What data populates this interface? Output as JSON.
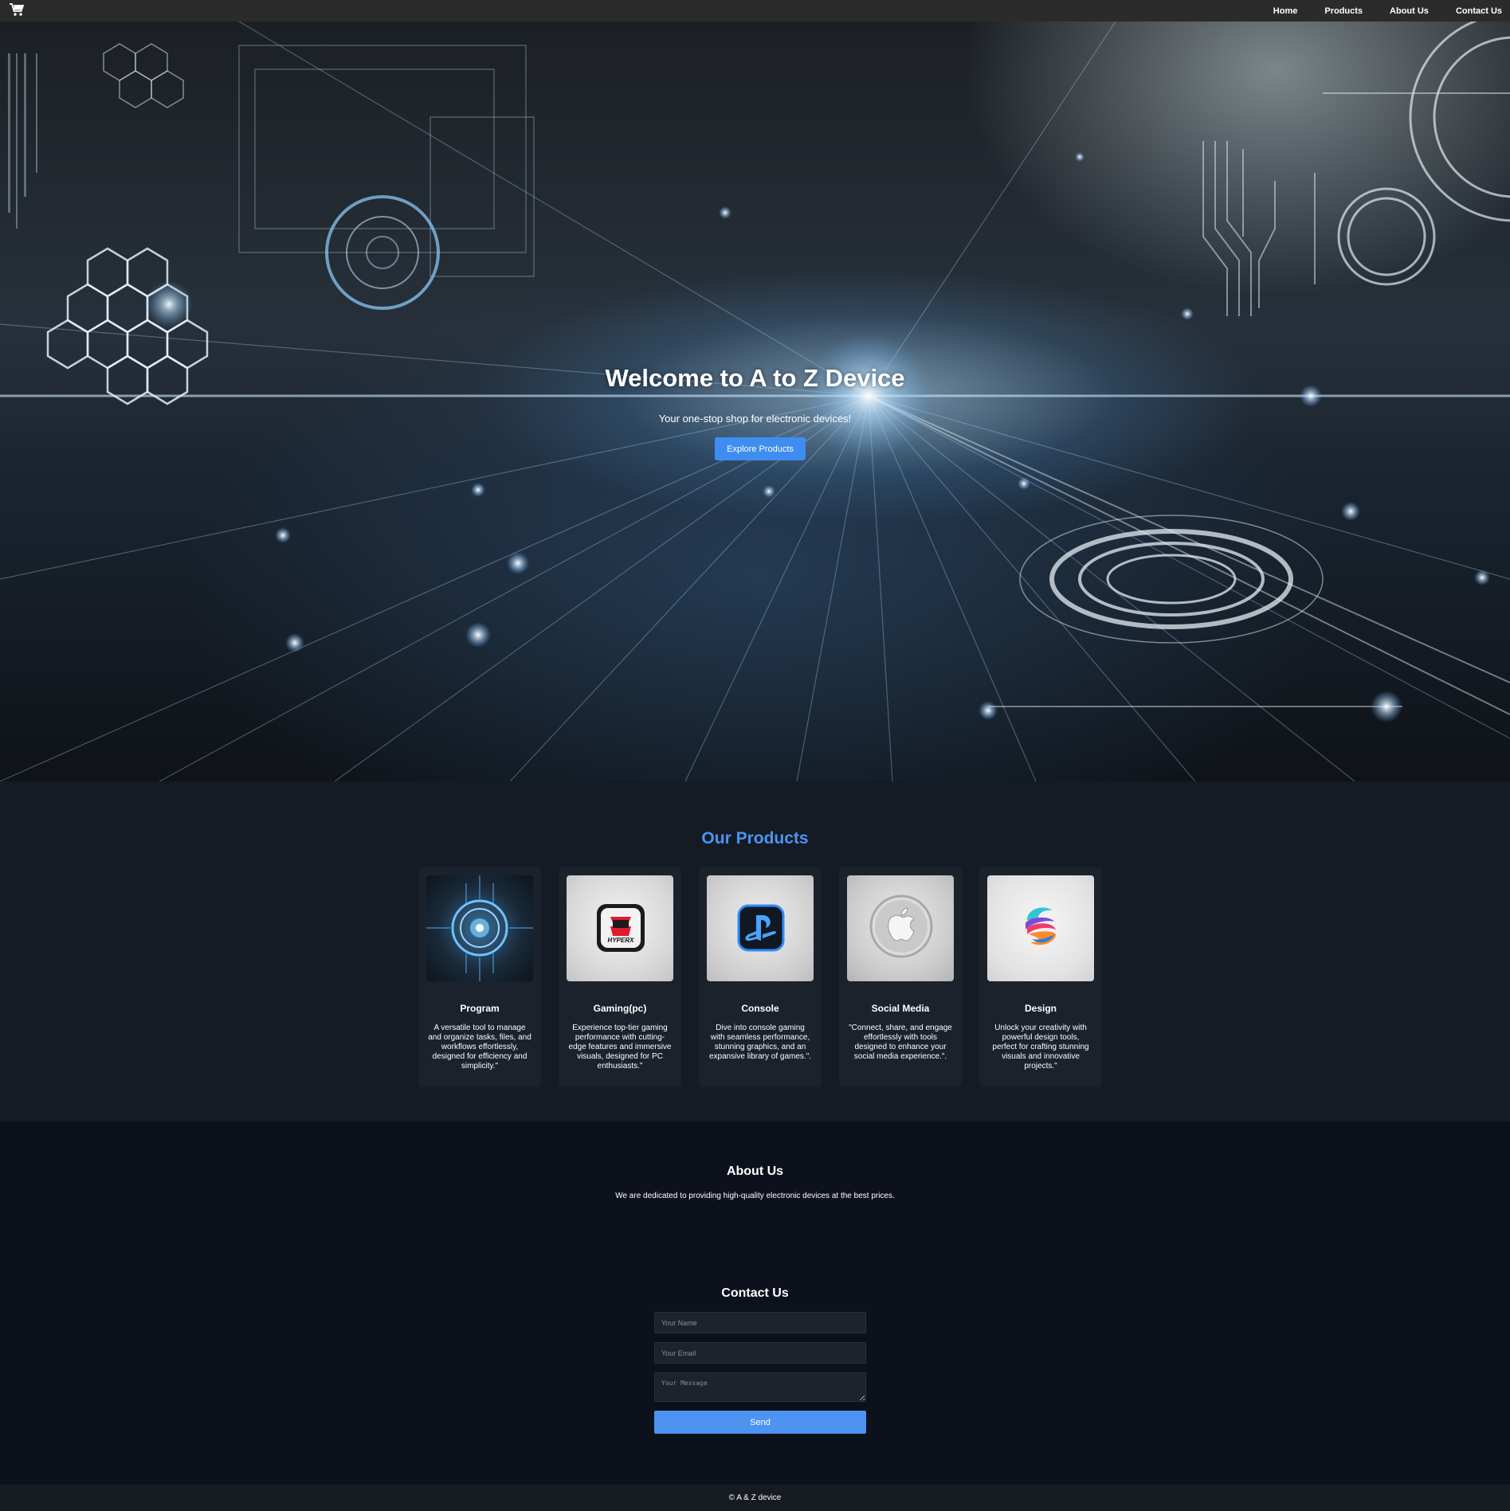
{
  "nav": {
    "cart_icon": "shopping-cart-icon",
    "links": [
      "Home",
      "Products",
      "About Us",
      "Contact Us"
    ]
  },
  "hero": {
    "title": "Welcome to A to Z Device",
    "subtitle": "Your one-stop shop for electronic devices!",
    "button_label": "Explore Products"
  },
  "products": {
    "title": "Our Products",
    "items": [
      {
        "name": "Program",
        "icon": "circuit-chip-icon",
        "description": "A versatile tool to manage and organize tasks, files, and workflows effortlessly, designed for efficiency and simplicity.\""
      },
      {
        "name": "Gaming(pc)",
        "icon": "hyperx-logo-icon",
        "description": "Experience top-tier gaming performance with cutting-edge features and immersive visuals, designed for PC enthusiasts.\""
      },
      {
        "name": "Console",
        "icon": "playstation-logo-icon",
        "description": "Dive into console gaming with seamless performance, stunning graphics, and an expansive library of games.\"."
      },
      {
        "name": "Social Media",
        "icon": "apple-logo-icon",
        "description": "\"Connect, share, and engage effortlessly with tools designed to enhance your social media experience.\"."
      },
      {
        "name": "Design",
        "icon": "design-swirl-icon",
        "description": "Unlock your creativity with powerful design tools, perfect for crafting stunning visuals and innovative projects.\""
      }
    ]
  },
  "about": {
    "title": "About Us",
    "text": "We are dedicated to providing high-quality electronic devices at the best prices."
  },
  "contact": {
    "title": "Contact Us",
    "name_placeholder": "Your Name",
    "email_placeholder": "Your Email",
    "message_placeholder": "Your Message",
    "send_label": "Send"
  },
  "footer": {
    "text": "© A & Z device"
  },
  "colors": {
    "accent": "#4c93f2",
    "nav_bg": "#2b2b2c",
    "products_bg": "#141b24",
    "page_bg": "#0c111b"
  }
}
